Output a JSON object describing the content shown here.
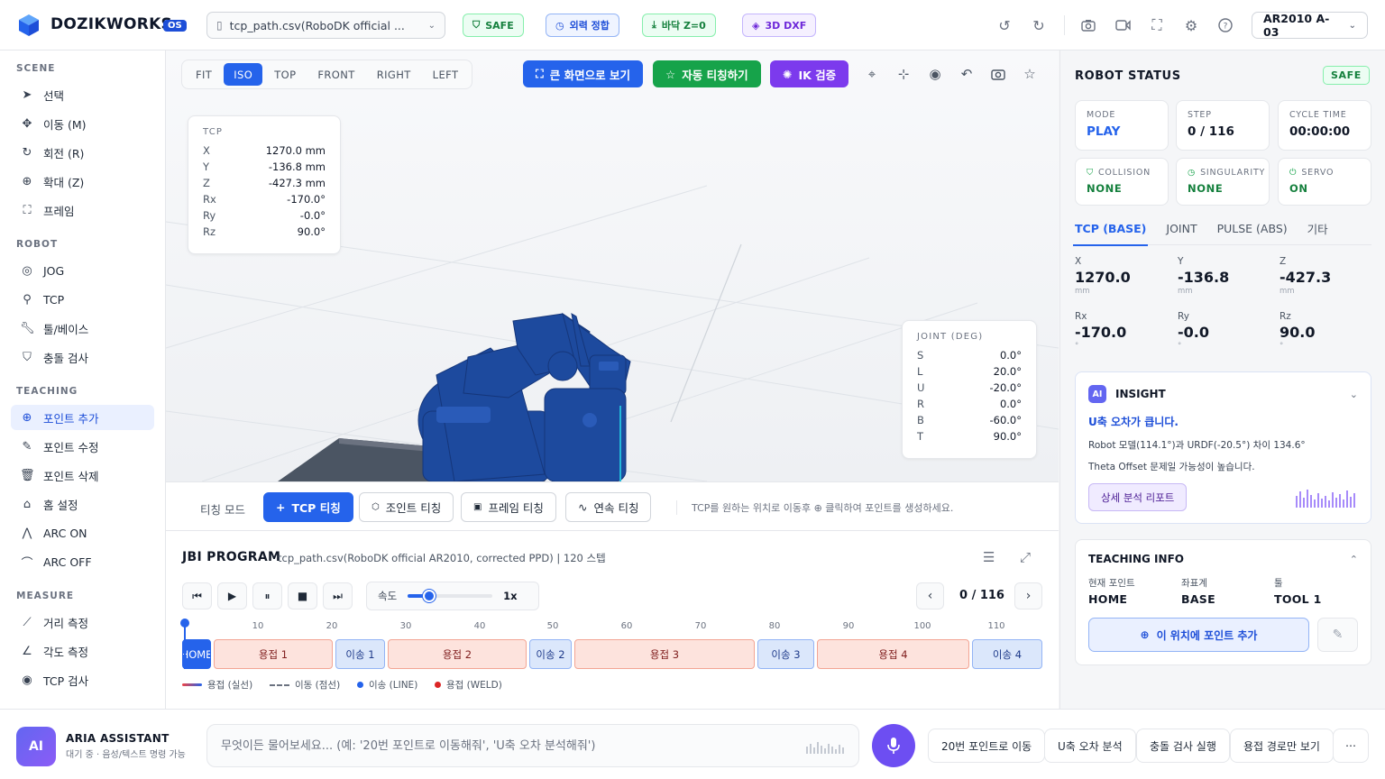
{
  "header": {
    "brand": "DOZIKWORKS",
    "os_badge": "OS",
    "file_name": "tcp_path.csv(RoboDK official ...",
    "status_pills": {
      "safe": "SAFE",
      "calibration": "외력 정합",
      "floor": "바닥 Z=0",
      "dxf": "3D DXF"
    },
    "robot_select": "AR2010 A-03"
  },
  "sidebar": {
    "scene_title": "SCENE",
    "scene_items": [
      "선택",
      "이동 (M)",
      "회전 (R)",
      "확대 (Z)",
      "프레임"
    ],
    "robot_title": "ROBOT",
    "robot_items": [
      "JOG",
      "TCP",
      "툴/베이스",
      "충돌 검사"
    ],
    "teaching_title": "TEACHING",
    "teaching_items": [
      "포인트 추가",
      "포인트 수정",
      "포인트 삭제",
      "홈 설정",
      "ARC ON",
      "ARC OFF"
    ],
    "measure_title": "MEASURE",
    "measure_items": [
      "거리 측정",
      "각도 측정",
      "TCP 검사"
    ]
  },
  "viewport": {
    "view_tabs": [
      "FIT",
      "ISO",
      "TOP",
      "FRONT",
      "RIGHT",
      "LEFT"
    ],
    "active_view": "ISO",
    "fullscreen_label": "큰 화면으로 보기",
    "auto_teach_label": "자동 티칭하기",
    "ik_label": "IK 검증",
    "tcp_card": {
      "title": "TCP",
      "rows": [
        {
          "k": "X",
          "v": "1270.0 mm"
        },
        {
          "k": "Y",
          "v": "-136.8 mm"
        },
        {
          "k": "Z",
          "v": "-427.3 mm"
        },
        {
          "k": "Rx",
          "v": "-170.0°"
        },
        {
          "k": "Ry",
          "v": "-0.0°"
        },
        {
          "k": "Rz",
          "v": "90.0°"
        }
      ]
    },
    "joint_card": {
      "title": "JOINT (DEG)",
      "rows": [
        {
          "k": "S",
          "v": "0.0°"
        },
        {
          "k": "L",
          "v": "20.0°"
        },
        {
          "k": "U",
          "v": "-20.0°"
        },
        {
          "k": "R",
          "v": "0.0°"
        },
        {
          "k": "B",
          "v": "-60.0°"
        },
        {
          "k": "T",
          "v": "90.0°"
        }
      ]
    }
  },
  "teach_bar": {
    "label": "티칭 모드",
    "buttons": [
      "TCP 티칭",
      "조인트 티칭",
      "프레임 티칭",
      "연속 티칭"
    ],
    "hint": "TCP를 원하는 위치로 이동후 ⊕ 클릭하여 포인트를 생성하세요."
  },
  "program": {
    "title": "JBI PROGRAM",
    "subtitle": "tcp_path.csv(RoboDK official AR2010, corrected PPD) | 120 스텝",
    "speed_label": "속도",
    "speed_value": "1x",
    "speed_fraction": 0.25,
    "step_text": "0 / 116",
    "ticks": [
      "10",
      "20",
      "30",
      "40",
      "50",
      "60",
      "70",
      "80",
      "90",
      "100",
      "110"
    ],
    "segments": [
      {
        "label": "HOME",
        "type": "home"
      },
      {
        "label": "용접 1",
        "type": "weld"
      },
      {
        "label": "이송 1",
        "type": "move"
      },
      {
        "label": "용접 2",
        "type": "weld"
      },
      {
        "label": "이송 2",
        "type": "move"
      },
      {
        "label": "용접 3",
        "type": "weld"
      },
      {
        "label": "이송 3",
        "type": "move"
      },
      {
        "label": "용접 4",
        "type": "weld"
      },
      {
        "label": "이송 4",
        "type": "move"
      }
    ],
    "legend": [
      "용접 (실선)",
      "이동 (점선)",
      "이송 (LINE)",
      "용접 (WELD)"
    ]
  },
  "robot_status": {
    "title": "ROBOT STATUS",
    "badge": "SAFE",
    "mode": {
      "label": "MODE",
      "value": "PLAY"
    },
    "step": {
      "label": "STEP",
      "value": "0 / 116"
    },
    "cycle": {
      "label": "CYCLE TIME",
      "value": "00:00:00"
    },
    "collision": {
      "label": "COLLISION",
      "value": "NONE"
    },
    "singularity": {
      "label": "SINGULARITY",
      "value": "NONE"
    },
    "servo": {
      "label": "SERVO",
      "value": "ON"
    },
    "tabs": [
      "TCP (BASE)",
      "JOINT",
      "PULSE (ABS)",
      "기타"
    ],
    "coords": [
      {
        "k": "X",
        "v": "1270.0",
        "u": "mm"
      },
      {
        "k": "Y",
        "v": "-136.8",
        "u": "mm"
      },
      {
        "k": "Z",
        "v": "-427.3",
        "u": "mm"
      },
      {
        "k": "Rx",
        "v": "-170.0",
        "u": "°"
      },
      {
        "k": "Ry",
        "v": "-0.0",
        "u": "°"
      },
      {
        "k": "Rz",
        "v": "90.0",
        "u": "°"
      }
    ]
  },
  "insight": {
    "chip": "AI",
    "title": "INSIGHT",
    "headline": "U축 오차가 큽니다.",
    "line1": "Robot 모델(114.1°)과 URDF(-20.5°) 차이 134.6°",
    "line2": "Theta Offset 문제일 가능성이 높습니다.",
    "report_button": "상세 분석 리포트"
  },
  "teaching_info": {
    "title": "TEACHING INFO",
    "current_point_label": "현재 포인트",
    "current_point": "HOME",
    "coord_system_label": "좌표계",
    "coord_system": "BASE",
    "tool_label": "툴",
    "tool": "TOOL 1",
    "add_button": "이 위치에 포인트 추가"
  },
  "assistant": {
    "avatar": "AI",
    "name": "ARIA ASSISTANT",
    "status": "대기 중 · 음성/텍스트 명령 가능",
    "placeholder": "무엇이든 물어보세요... (예: '20번 포인트로 이동해줘', 'U축 오차 분석해줘')",
    "quick_actions": [
      "20번 포인트로 이동",
      "U축 오차 분석",
      "충돌 검사 실행",
      "용접 경로만 보기"
    ],
    "more": "⋯"
  },
  "colors": {
    "accent": "#2563eb",
    "safe_green": "#15803d",
    "weld_fill": "#fde3dd",
    "move_fill": "#dbe7fb",
    "robot_blue": "#1d4a9e",
    "ai_purple": "#6d4ef2"
  }
}
